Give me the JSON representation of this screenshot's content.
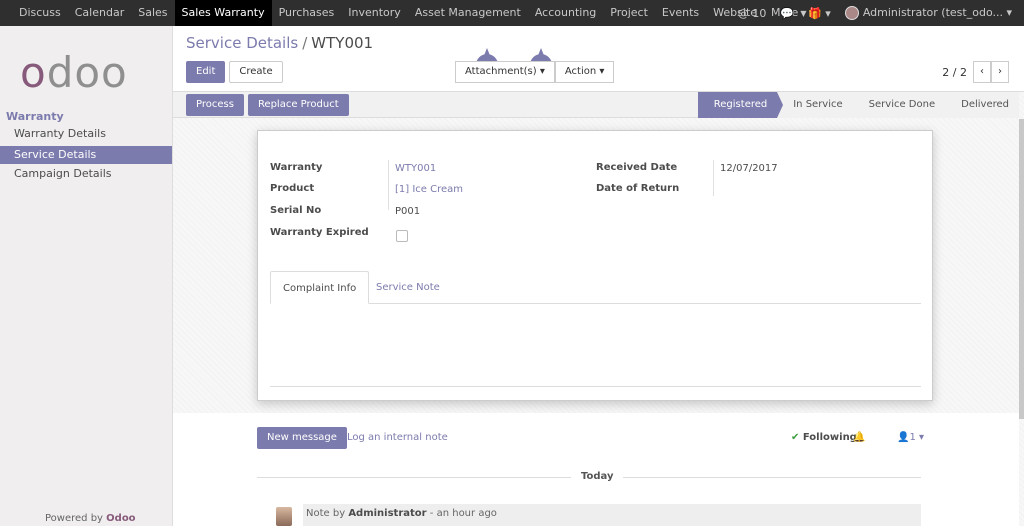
{
  "topnav": {
    "items": [
      "Discuss",
      "Calendar",
      "Sales",
      "Sales Warranty",
      "Purchases",
      "Inventory",
      "Asset Management",
      "Accounting",
      "Project",
      "Events",
      "Website",
      "More"
    ],
    "active": "Sales Warranty",
    "right": {
      "messages_count": "10",
      "user_name": "Administrator (test_odo..."
    }
  },
  "sidebar": {
    "logo": "odoo",
    "section": "Warranty",
    "items": [
      "Warranty Details",
      "Service Details",
      "Campaign Details"
    ],
    "active": "Service Details",
    "powered_by": "Powered by",
    "powered_brand": "Odoo"
  },
  "breadcrumb": {
    "parent": "Service Details",
    "separator": "/",
    "current": "WTY001"
  },
  "buttons": {
    "edit": "Edit",
    "create": "Create",
    "attachments": "Attachment(s)",
    "action": "Action"
  },
  "pager": {
    "value": "2 / 2"
  },
  "statusbar": {
    "actions": [
      "Process",
      "Replace Product"
    ],
    "stages": [
      "Registered",
      "In Service",
      "Service Done",
      "Delivered"
    ],
    "active_stage": "Registered"
  },
  "form": {
    "warranty_label": "Warranty",
    "warranty_value": "WTY001",
    "product_label": "Product",
    "product_value": "[1] Ice Cream",
    "serial_label": "Serial No",
    "serial_value": "P001",
    "expired_label": "Warranty Expired",
    "expired_checked": false,
    "received_label": "Received Date",
    "received_value": "12/07/2017",
    "return_label": "Date of Return",
    "return_value": ""
  },
  "tabs": [
    "Complaint Info",
    "Service Note"
  ],
  "chatter": {
    "new_message": "New message",
    "log_note": "Log an internal note",
    "following": "Following",
    "followers_count": "1",
    "today": "Today",
    "note_prefix": "Note by",
    "note_author": "Administrator",
    "note_time": "- an hour ago"
  },
  "colors": {
    "accent": "#7c7bad",
    "brand": "#875a7b",
    "topbar": "#2f2f2f"
  }
}
